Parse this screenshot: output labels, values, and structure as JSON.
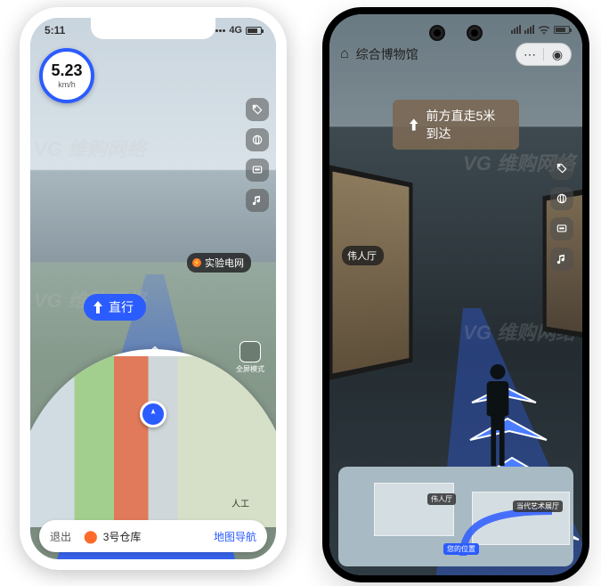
{
  "left": {
    "status": {
      "time": "5:11",
      "net": "4G"
    },
    "speed": {
      "value": "5.23",
      "unit": "km/h"
    },
    "icons": [
      "tag-icon",
      "link-icon",
      "message-icon",
      "music-icon"
    ],
    "poi": {
      "label": "实验电网"
    },
    "direction": {
      "label": "直行"
    },
    "fullscreen_label": "全屏模式",
    "minimap": {
      "poi_label": "人工"
    },
    "bottom": {
      "exit": "退出",
      "destination": "3号仓库",
      "nav_link": "地图导航"
    }
  },
  "right": {
    "appbar": {
      "title": "综合博物馆"
    },
    "banner": {
      "text": "前方直走5米到达"
    },
    "poi": {
      "label": "伟人厅"
    },
    "icons": [
      "tag-icon",
      "qr-icon",
      "message-icon",
      "music-icon"
    ],
    "minimap": {
      "label_a": "伟人厅",
      "label_b": "当代艺术展厅",
      "label_you": "您的位置"
    }
  },
  "watermark": "VG 维购网络"
}
